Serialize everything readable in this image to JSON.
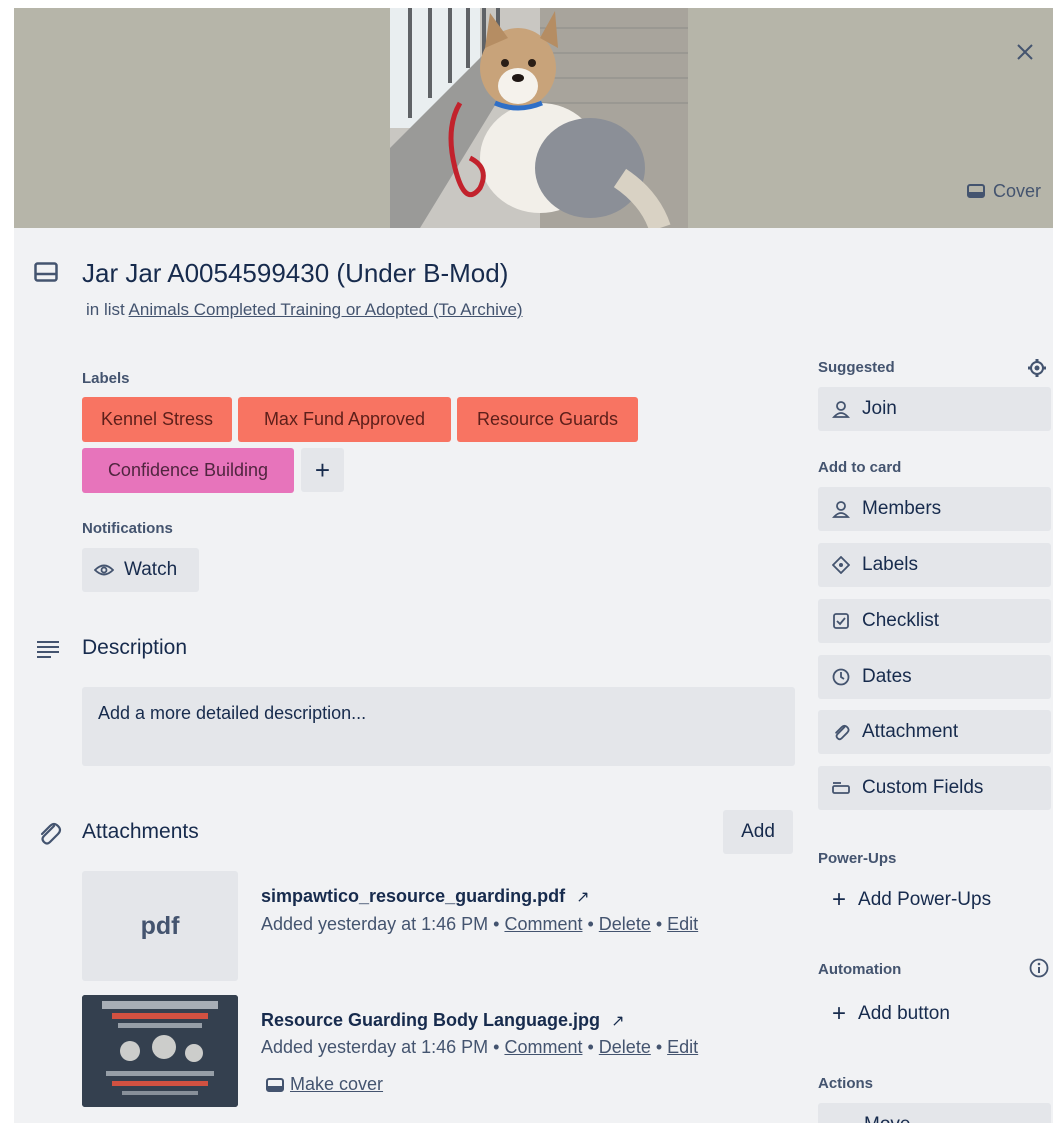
{
  "card": {
    "title": "Jar Jar A0054599430 (Under B-Mod)",
    "in_list_prefix": "in list",
    "list_name": "Animals Completed Training or Adopted (To Archive)"
  },
  "cover": {
    "button_label": "Cover"
  },
  "labels": {
    "heading": "Labels",
    "items": [
      {
        "text": "Kennel Stress",
        "color": "#f87462"
      },
      {
        "text": "Max Fund Approved",
        "color": "#f87462"
      },
      {
        "text": "Resource Guards",
        "color": "#f87462"
      },
      {
        "text": "Confidence Building",
        "color": "#e774bb"
      }
    ],
    "add_symbol": "+"
  },
  "notifications": {
    "heading": "Notifications",
    "watch_label": "Watch"
  },
  "description": {
    "title": "Description",
    "placeholder": "Add a more detailed description..."
  },
  "attachments": {
    "title": "Attachments",
    "add_label": "Add",
    "items": [
      {
        "thumb_text": "pdf",
        "name": "simpawtico_resource_guarding.pdf",
        "added": "Added yesterday at 1:46 PM",
        "comment": "Comment",
        "delete": "Delete",
        "edit": "Edit"
      },
      {
        "name": "Resource Guarding Body Language.jpg",
        "added": "Added yesterday at 1:46 PM",
        "comment": "Comment",
        "delete": "Delete",
        "edit": "Edit",
        "make_cover": "Make cover"
      }
    ]
  },
  "sidebar": {
    "suggested": "Suggested",
    "join": "Join",
    "add_to_card": "Add to card",
    "members": "Members",
    "labels": "Labels",
    "checklist": "Checklist",
    "dates": "Dates",
    "attachment": "Attachment",
    "custom_fields": "Custom Fields",
    "power_ups": "Power-Ups",
    "add_power_ups": "Add Power-Ups",
    "automation": "Automation",
    "add_button": "Add button",
    "actions": "Actions",
    "move": "Move"
  },
  "colors": {
    "modal_bg": "#f1f2f4",
    "button_bg": "#e4e6ea",
    "label_red": "#f87462",
    "label_pink": "#e774bb",
    "cover_bg": "#b6b5a9"
  }
}
